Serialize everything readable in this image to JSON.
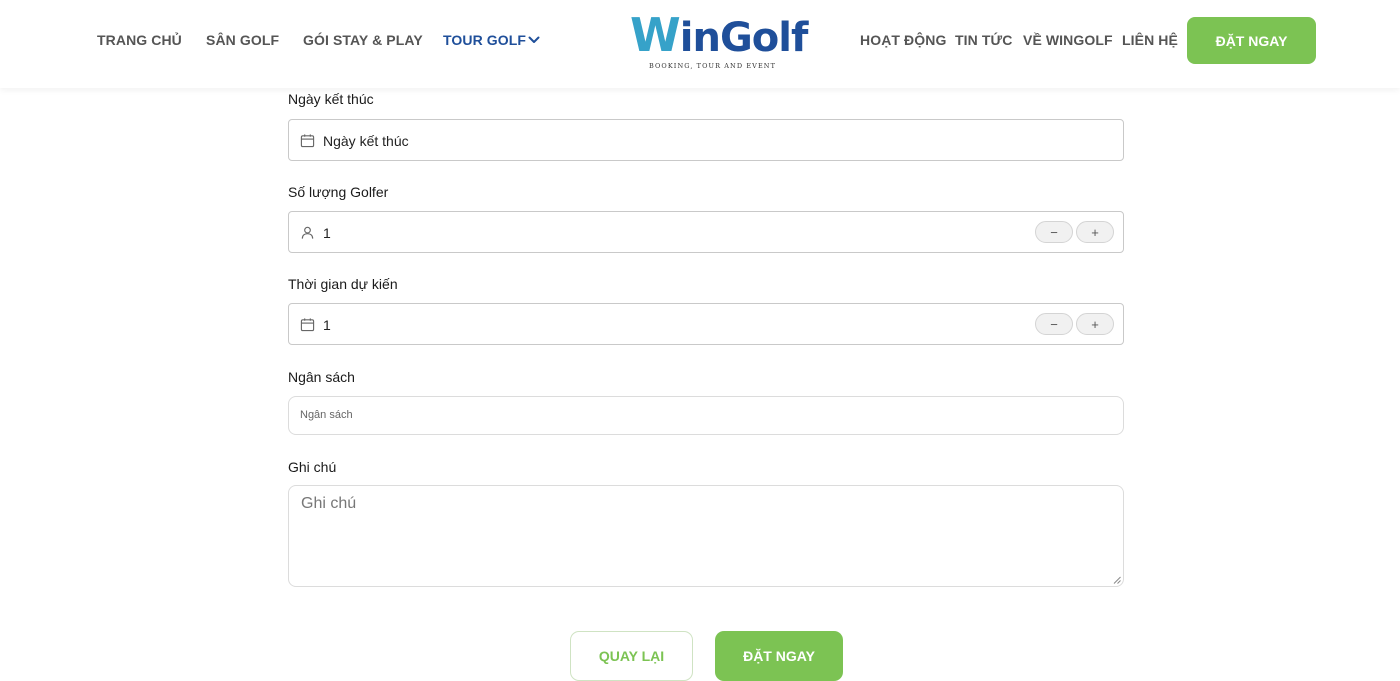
{
  "nav": {
    "home": "TRANG CHỦ",
    "courses": "SÂN GOLF",
    "stay_play": "GÓI STAY & PLAY",
    "tour": "TOUR GOLF",
    "activities": "HOẠT ĐỘNG",
    "news": "TIN TỨC",
    "about": "VỀ WINGOLF",
    "contact": "LIÊN HỆ",
    "book_now": "ĐẶT NGAY"
  },
  "logo": {
    "w": "W",
    "rest": "inGolf",
    "tagline": "BOOKING, TOUR AND EVENT"
  },
  "form": {
    "end_date": {
      "label": "Ngày kết thúc",
      "value": "Ngày kết thúc"
    },
    "golfers": {
      "label": "Số lượng Golfer",
      "value": "1",
      "minus": "−",
      "plus": "+"
    },
    "duration": {
      "label": "Thời gian dự kiến",
      "value": "1",
      "minus": "−",
      "plus": "+"
    },
    "budget": {
      "label": "Ngân sách",
      "placeholder": "Ngân sách"
    },
    "note": {
      "label": "Ghi chú",
      "placeholder": "Ghi chú"
    }
  },
  "actions": {
    "back": "QUAY LẠI",
    "book_now": "ĐẶT NGAY"
  },
  "colors": {
    "accent_green": "#7cc353",
    "brand_blue": "#1f4f9a",
    "brand_teal": "#36a2c9"
  }
}
